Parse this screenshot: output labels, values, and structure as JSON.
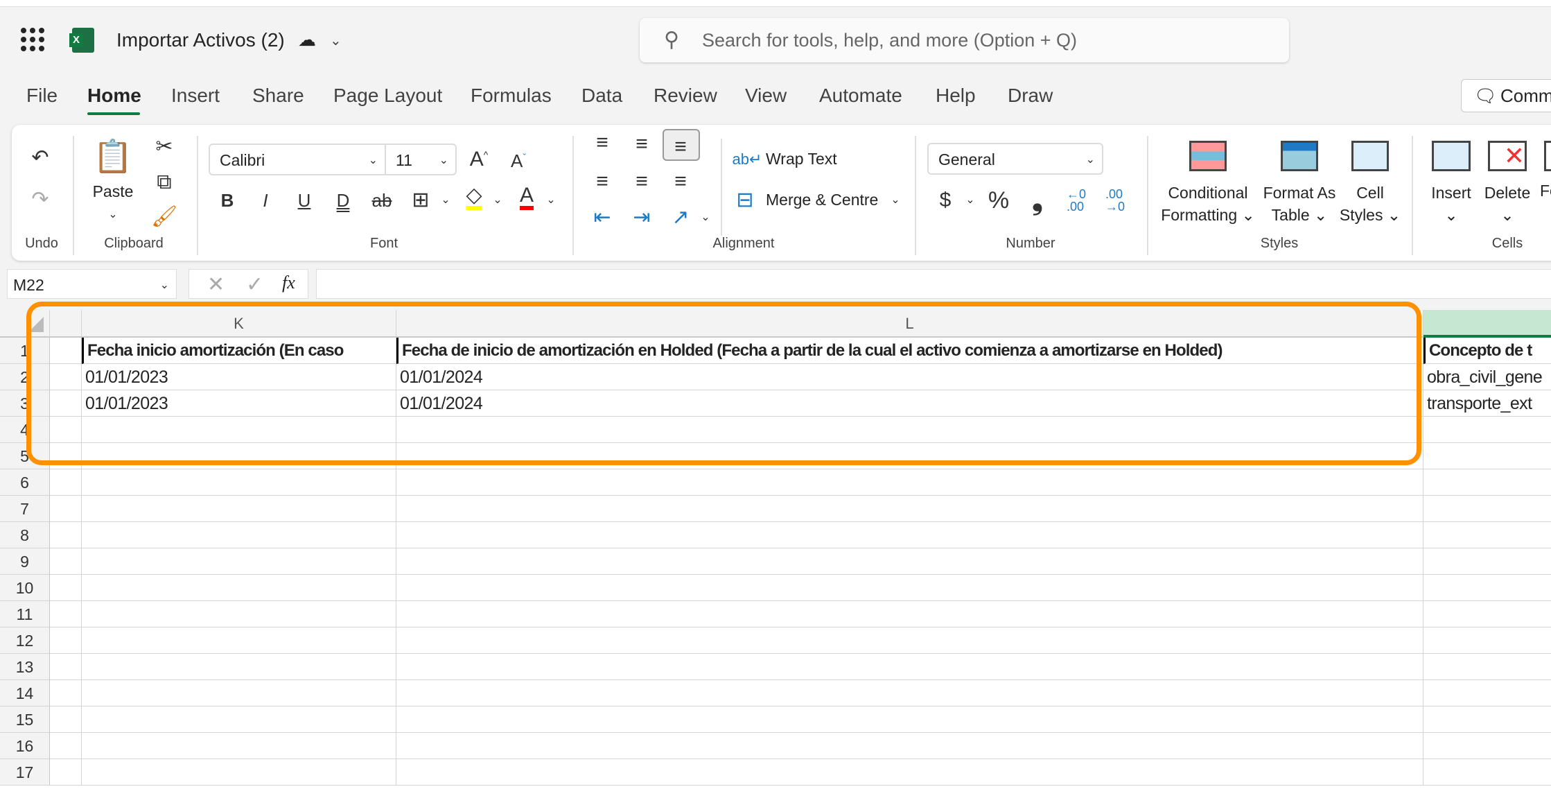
{
  "titlebar": {
    "doc_title": "Importar Activos (2)",
    "search_placeholder": "Search for tools, help, and more (Option + Q)"
  },
  "tabs": [
    {
      "label": "File"
    },
    {
      "label": "Home",
      "active": true
    },
    {
      "label": "Insert"
    },
    {
      "label": "Share"
    },
    {
      "label": "Page Layout"
    },
    {
      "label": "Formulas"
    },
    {
      "label": "Data"
    },
    {
      "label": "Review"
    },
    {
      "label": "View"
    },
    {
      "label": "Automate"
    },
    {
      "label": "Help"
    },
    {
      "label": "Draw"
    }
  ],
  "comments_label": "Comments",
  "ribbon": {
    "undo_group": "Undo",
    "clipboard": {
      "group": "Clipboard",
      "paste": "Paste"
    },
    "font": {
      "group": "Font",
      "name": "Calibri",
      "size": "11",
      "bold": "B",
      "italic": "I",
      "underline": "U",
      "double_underline": "D",
      "strike": "ab",
      "color_fill": "#ffff00",
      "color_font": "#ff0000"
    },
    "alignment": {
      "group": "Alignment",
      "wrap_text": "Wrap Text",
      "merge": "Merge & Centre"
    },
    "number": {
      "group": "Number",
      "format": "General",
      "currency": "$",
      "percent": "%",
      "comma": "❟"
    },
    "styles": {
      "group": "Styles",
      "conditional_1": "Conditional",
      "conditional_2": "Formatting",
      "format_table_1": "Format As",
      "format_table_2": "Table",
      "cell_styles_1": "Cell",
      "cell_styles_2": "Styles"
    },
    "cells": {
      "group": "Cells",
      "insert": "Insert",
      "delete": "Delete",
      "format": "Fo"
    }
  },
  "formula_bar": {
    "name_box": "M22",
    "fx": "fx",
    "value": ""
  },
  "sheet": {
    "columns": [
      "",
      "K",
      "L",
      ""
    ],
    "selected_column_color": "#c6e7d2",
    "row_numbers": [
      "1",
      "2",
      "3",
      "4",
      "5",
      "6",
      "7",
      "8",
      "9",
      "10",
      "11",
      "12",
      "13",
      "14",
      "15",
      "16",
      "17"
    ],
    "rows": [
      [
        "",
        "Fecha inicio amortización (En caso",
        "Fecha de inicio de amortización en Holded (Fecha a partir de la cual el activo comienza a amortizarse en Holded)",
        "Concepto de t"
      ],
      [
        "",
        "01/01/2023",
        "01/01/2024",
        "obra_civil_gene"
      ],
      [
        "",
        "01/01/2023",
        "01/01/2024",
        "transporte_ext"
      ]
    ]
  },
  "highlight_color": "#ff9100"
}
